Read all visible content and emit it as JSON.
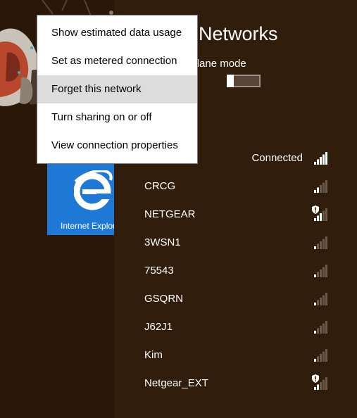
{
  "charm": {
    "title": "Networks",
    "airplane_mode_label": "Airplane mode",
    "airplane_mode_on": false
  },
  "start_tile": {
    "label": "Internet Explorer",
    "color": "#1e78d6"
  },
  "networks": [
    {
      "name": "",
      "status": "Connected",
      "secured_warning": false,
      "signal_bars": 5
    },
    {
      "name": "CRCG",
      "status": "",
      "secured_warning": false,
      "signal_bars": 2
    },
    {
      "name": "NETGEAR",
      "status": "",
      "secured_warning": true,
      "signal_bars": 3
    },
    {
      "name": "3WSN1",
      "status": "",
      "secured_warning": false,
      "signal_bars": 1
    },
    {
      "name": "75543",
      "status": "",
      "secured_warning": false,
      "signal_bars": 1
    },
    {
      "name": "GSQRN",
      "status": "",
      "secured_warning": false,
      "signal_bars": 1
    },
    {
      "name": "J62J1",
      "status": "",
      "secured_warning": false,
      "signal_bars": 1
    },
    {
      "name": "Kim",
      "status": "",
      "secured_warning": false,
      "signal_bars": 1
    },
    {
      "name": "Netgear_EXT",
      "status": "",
      "secured_warning": true,
      "signal_bars": 2
    }
  ],
  "context_menu": {
    "items": [
      {
        "label": "Show estimated data usage",
        "highlighted": false
      },
      {
        "label": "Set as metered connection",
        "highlighted": false
      },
      {
        "label": "Forget this network",
        "highlighted": true
      },
      {
        "label": "Turn sharing on or off",
        "highlighted": false
      },
      {
        "label": "View connection properties",
        "highlighted": false
      }
    ]
  },
  "colors": {
    "charm_background": "#311d0b",
    "start_background": "#2b1708",
    "menu_highlight": "#dcdcdc"
  }
}
